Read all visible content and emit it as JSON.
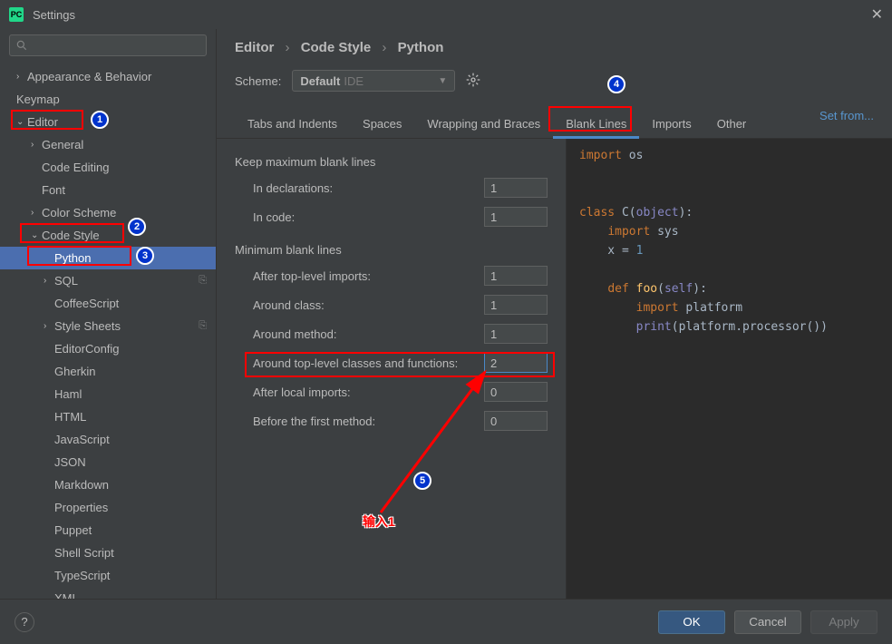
{
  "window": {
    "title": "Settings",
    "logo_text": "PC"
  },
  "sidebar": {
    "search_placeholder": "",
    "items": [
      {
        "label": "Appearance & Behavior",
        "arrow": ">",
        "indent": 0
      },
      {
        "label": "Keymap",
        "arrow": "",
        "indent": 0
      },
      {
        "label": "Editor",
        "arrow": "v",
        "indent": 0,
        "boxed": true,
        "badge": 1
      },
      {
        "label": "General",
        "arrow": ">",
        "indent": 1
      },
      {
        "label": "Code Editing",
        "arrow": "",
        "indent": 1
      },
      {
        "label": "Font",
        "arrow": "",
        "indent": 1
      },
      {
        "label": "Color Scheme",
        "arrow": ">",
        "indent": 1
      },
      {
        "label": "Code Style",
        "arrow": "v",
        "indent": 1,
        "boxed": true,
        "badge": 2
      },
      {
        "label": "Python",
        "arrow": "",
        "indent": 2,
        "selected": true,
        "boxed": true,
        "badge": 3
      },
      {
        "label": "SQL",
        "arrow": ">",
        "indent": 2,
        "copy": true
      },
      {
        "label": "CoffeeScript",
        "arrow": "",
        "indent": 2
      },
      {
        "label": "Style Sheets",
        "arrow": ">",
        "indent": 2,
        "copy": true
      },
      {
        "label": "EditorConfig",
        "arrow": "",
        "indent": 2
      },
      {
        "label": "Gherkin",
        "arrow": "",
        "indent": 2
      },
      {
        "label": "Haml",
        "arrow": "",
        "indent": 2
      },
      {
        "label": "HTML",
        "arrow": "",
        "indent": 2
      },
      {
        "label": "JavaScript",
        "arrow": "",
        "indent": 2
      },
      {
        "label": "JSON",
        "arrow": "",
        "indent": 2
      },
      {
        "label": "Markdown",
        "arrow": "",
        "indent": 2
      },
      {
        "label": "Properties",
        "arrow": "",
        "indent": 2
      },
      {
        "label": "Puppet",
        "arrow": "",
        "indent": 2
      },
      {
        "label": "Shell Script",
        "arrow": "",
        "indent": 2
      },
      {
        "label": "TypeScript",
        "arrow": "",
        "indent": 2
      },
      {
        "label": "XML",
        "arrow": "",
        "indent": 2
      }
    ]
  },
  "breadcrumb": {
    "a": "Editor",
    "b": "Code Style",
    "c": "Python"
  },
  "scheme": {
    "label": "Scheme:",
    "name": "Default",
    "suffix": "IDE"
  },
  "set_from": "Set from...",
  "tabs": [
    {
      "label": "Tabs and Indents"
    },
    {
      "label": "Spaces"
    },
    {
      "label": "Wrapping and Braces"
    },
    {
      "label": "Blank Lines",
      "active": true,
      "boxed": true,
      "badge": 4
    },
    {
      "label": "Imports"
    },
    {
      "label": "Other"
    }
  ],
  "sections": {
    "max": {
      "title": "Keep maximum blank lines",
      "rows": [
        {
          "label": "In declarations:",
          "value": "1"
        },
        {
          "label": "In code:",
          "value": "1"
        }
      ]
    },
    "min": {
      "title": "Minimum blank lines",
      "rows": [
        {
          "label": "After top-level imports:",
          "value": "1"
        },
        {
          "label": "Around class:",
          "value": "1"
        },
        {
          "label": "Around method:",
          "value": "1"
        },
        {
          "label": "Around top-level classes and functions:",
          "value": "2",
          "focused": true,
          "boxed": true
        },
        {
          "label": "After local imports:",
          "value": "0"
        },
        {
          "label": "Before the first method:",
          "value": "0"
        }
      ]
    }
  },
  "annotation": {
    "badge5": "5",
    "input_label": "输入1"
  },
  "preview": {
    "lines": [
      {
        "t": "import",
        "c": "kw",
        "rest": " os"
      },
      {
        "blank": true
      },
      {
        "blank": true
      },
      {
        "text_parts": [
          {
            "t": "class ",
            "c": "kw"
          },
          {
            "t": "C",
            "c": "plain"
          },
          {
            "t": "(",
            "c": "plain"
          },
          {
            "t": "object",
            "c": "builtin"
          },
          {
            "t": "):",
            "c": "plain"
          }
        ]
      },
      {
        "text_parts": [
          {
            "t": "    ",
            "c": "plain"
          },
          {
            "t": "import",
            "c": "kw"
          },
          {
            "t": " sys",
            "c": "plain"
          }
        ]
      },
      {
        "text_parts": [
          {
            "t": "    x = ",
            "c": "plain"
          },
          {
            "t": "1",
            "c": "num"
          }
        ]
      },
      {
        "blank": true
      },
      {
        "text_parts": [
          {
            "t": "    ",
            "c": "plain"
          },
          {
            "t": "def ",
            "c": "kw"
          },
          {
            "t": "foo",
            "c": "fn"
          },
          {
            "t": "(",
            "c": "plain"
          },
          {
            "t": "self",
            "c": "builtin"
          },
          {
            "t": "):",
            "c": "plain"
          }
        ]
      },
      {
        "text_parts": [
          {
            "t": "        ",
            "c": "plain"
          },
          {
            "t": "import",
            "c": "kw"
          },
          {
            "t": " platform",
            "c": "plain"
          }
        ]
      },
      {
        "text_parts": [
          {
            "t": "        ",
            "c": "plain"
          },
          {
            "t": "print",
            "c": "builtin"
          },
          {
            "t": "(platform.processor())",
            "c": "plain"
          }
        ]
      }
    ]
  },
  "footer": {
    "help": "?",
    "ok": "OK",
    "cancel": "Cancel",
    "apply": "Apply"
  }
}
